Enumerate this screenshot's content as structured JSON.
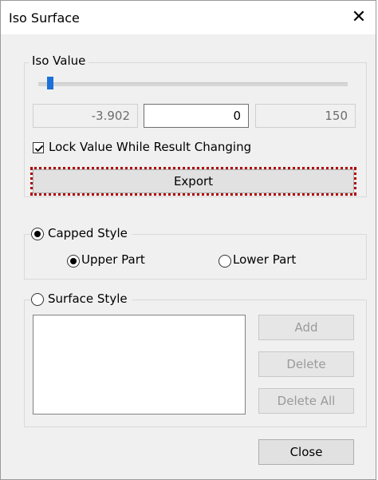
{
  "window": {
    "title": "Iso Surface"
  },
  "iso_value": {
    "legend": "Iso Value",
    "slider_position": 0.03,
    "min_value": "-3.902",
    "current_value": "0",
    "max_value": "150",
    "lock_label": "Lock Value While Result Changing",
    "lock_checked": true,
    "export_label": "Export"
  },
  "capped_style": {
    "label": "Capped Style",
    "selected": true,
    "upper_label": "Upper Part",
    "upper_selected": true,
    "lower_label": "Lower Part",
    "lower_selected": false
  },
  "surface_style": {
    "label": "Surface Style",
    "selected": false,
    "add_label": "Add",
    "delete_label": "Delete",
    "delete_all_label": "Delete All"
  },
  "close_label": "Close",
  "colors": {
    "slider_thumb": "#1e6fd8",
    "focus_outline": "#b00000"
  }
}
